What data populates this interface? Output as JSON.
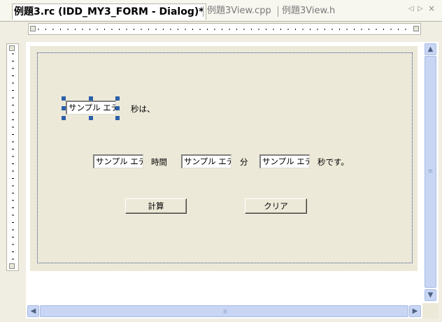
{
  "tabs": [
    {
      "label": "例題3.rc (IDD_MY3_FORM - Dialog)*",
      "active": true
    },
    {
      "label": "例題3View.cpp",
      "active": false
    },
    {
      "label": "例題3View.h",
      "active": false
    }
  ],
  "tab_nav": {
    "prev": "◁",
    "next": "▷",
    "close": "×"
  },
  "dialog": {
    "edit_default_text": "サンプル エディット",
    "label_seconds_is": "秒は、",
    "label_hours": "時間",
    "label_minutes": "分",
    "label_seconds_end": "秒です。",
    "button_calculate": "計算",
    "button_clear": "クリア"
  },
  "scrollbars": {
    "up_arrow": "▲",
    "down_arrow": "▼",
    "left_arrow": "◀",
    "right_arrow": "▶"
  },
  "colors": {
    "dialog_bg": "#ece9d8",
    "selection_handle": "#2c5fa8",
    "scrollbar": "#c8d6f3"
  }
}
